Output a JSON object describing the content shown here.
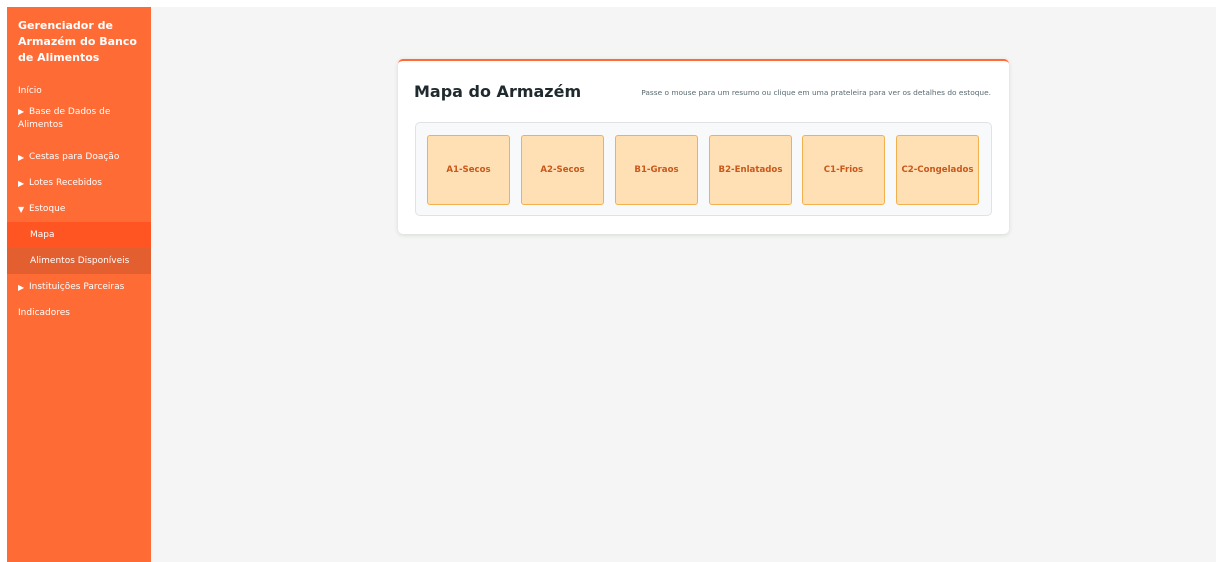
{
  "app": {
    "title": "Gerenciador de Armazém do Banco de Alimentos"
  },
  "sidebar": {
    "inicio": "Início",
    "base_dados": "Base de Dados de Alimentos",
    "cestas": "Cestas para Doação",
    "lotes": "Lotes Recebidos",
    "estoque": "Estoque",
    "estoque_sub": {
      "mapa": "Mapa",
      "alimentos": "Alimentos Disponíveis"
    },
    "instituicoes": "Instituições Parceiras",
    "indicadores": "Indicadores",
    "collapsed_arrow": "▶",
    "expanded_arrow": "▼"
  },
  "main": {
    "title": "Mapa do Armazém",
    "hint": "Passe o mouse para um resumo ou clique em uma prateleira para ver os detalhes do estoque.",
    "shelves": [
      {
        "label": "A1-Secos"
      },
      {
        "label": "A2-Secos"
      },
      {
        "label": "B1-Graos"
      },
      {
        "label": "B2-Enlatados"
      },
      {
        "label": "C1-Frios"
      },
      {
        "label": "C2-Congelados"
      }
    ]
  },
  "colors": {
    "accent": "#ff6b35",
    "active_item": "#ff5522",
    "shelf_fill": "#ffe0b5",
    "shelf_border": "#f3b04e",
    "shelf_text": "#c9581a"
  }
}
